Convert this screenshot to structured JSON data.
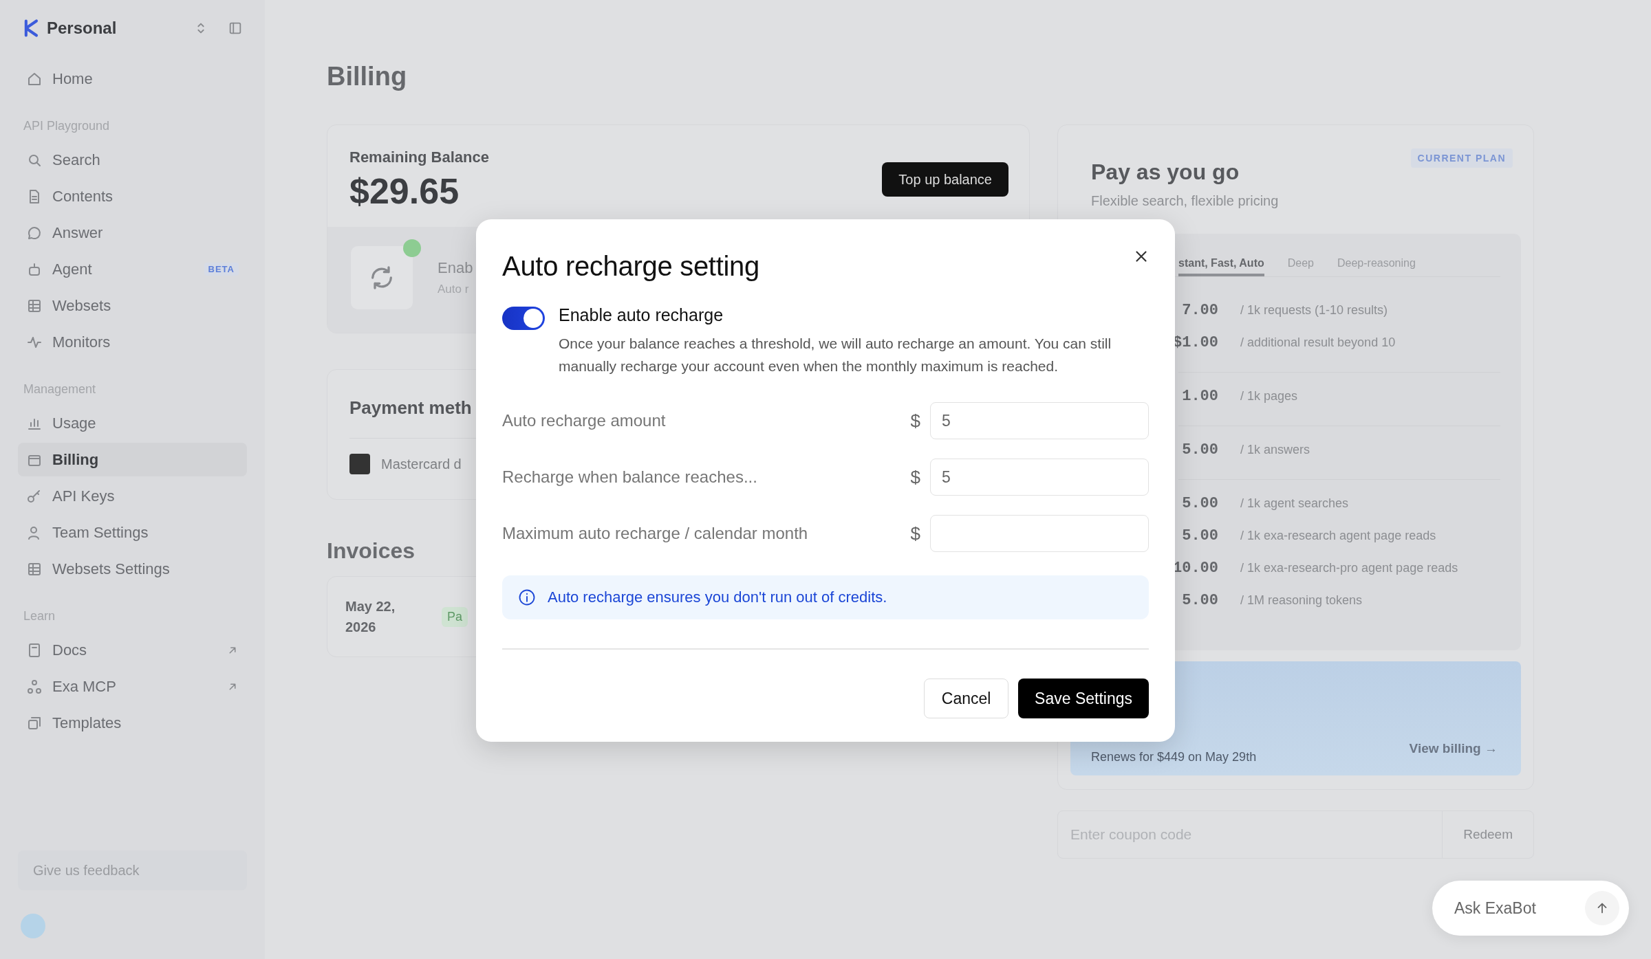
{
  "sidebar": {
    "workspace": "Personal",
    "sections": [
      {
        "items": [
          {
            "label": "Home",
            "selected": false,
            "external": false
          }
        ]
      },
      {
        "heading": "API Playground",
        "items": [
          {
            "label": "Search",
            "selected": false,
            "external": false
          },
          {
            "label": "Contents",
            "selected": false,
            "external": false
          },
          {
            "label": "Answer",
            "selected": false,
            "external": false
          },
          {
            "label": "Agent",
            "selected": false,
            "external": false,
            "badge": "BETA"
          },
          {
            "label": "Websets",
            "selected": false,
            "external": false
          },
          {
            "label": "Monitors",
            "selected": false,
            "external": false
          }
        ]
      },
      {
        "heading": "Management",
        "items": [
          {
            "label": "Usage",
            "selected": false,
            "external": false
          },
          {
            "label": "Billing",
            "selected": true,
            "external": false
          },
          {
            "label": "API Keys",
            "selected": false,
            "external": false
          },
          {
            "label": "Team Settings",
            "selected": false,
            "external": false
          },
          {
            "label": "Websets Settings",
            "selected": false,
            "external": false
          }
        ]
      },
      {
        "heading": "Learn",
        "items": [
          {
            "label": "Docs",
            "selected": false,
            "external": true
          },
          {
            "label": "Exa MCP",
            "selected": false,
            "external": true
          },
          {
            "label": "Templates",
            "selected": false,
            "external": false
          }
        ]
      }
    ],
    "feedback_button": "Give us feedback"
  },
  "page": {
    "title": "Billing",
    "balance_card": {
      "label": "Remaining Balance",
      "amount": "$29.65",
      "button": "Top up balance",
      "recharge_title": "Enab",
      "recharge_subtitle": "Auto r"
    },
    "payment_card": {
      "title": "Payment meth",
      "card": "Mastercard d"
    },
    "invoices": {
      "title": "Invoices",
      "rows": [
        {
          "date": "May 22, 2026",
          "status": "Pa"
        }
      ]
    },
    "plan_card": {
      "title": "Pay as you go",
      "subtitle": "Flexible search, flexible pricing",
      "badge": "CURRENT PLAN",
      "tabs": [
        {
          "label": "stant, Fast, Auto",
          "selected": true
        },
        {
          "label": "Deep",
          "selected": false
        },
        {
          "label": "Deep-reasoning",
          "selected": false
        }
      ],
      "price_groups": [
        [
          {
            "price": "7.00",
            "unit": "/ 1k requests (1-10 results)"
          },
          {
            "price": "$1.00",
            "unit": "/ additional result beyond 10"
          }
        ],
        [
          {
            "price": "1.00",
            "unit": "/ 1k pages"
          }
        ],
        [
          {
            "price": "5.00",
            "unit": "/ 1k answers"
          }
        ],
        [
          {
            "price": "5.00",
            "unit": "/ 1k agent searches"
          },
          {
            "price": "5.00",
            "unit": "/ 1k exa-research agent page reads"
          },
          {
            "price": "10.00",
            "unit": "/ 1k exa-research-pro agent page reads"
          },
          {
            "price": "5.00",
            "unit": "/ 1M reasoning tokens"
          }
        ]
      ],
      "renewal": "Renews for $449 on May 29th",
      "view_billing": "View billing →"
    },
    "coupon": {
      "placeholder": "Enter coupon code",
      "button": "Redeem"
    }
  },
  "modal": {
    "title": "Auto recharge setting",
    "toggle": {
      "label": "Enable auto recharge",
      "on": true
    },
    "description": "Once your balance reaches a threshold, we will auto recharge an amount. You can still manually recharge your account even when the monthly maximum is reached.",
    "fields": [
      {
        "label": "Auto recharge amount",
        "currency": "$",
        "value": "5"
      },
      {
        "label": "Recharge when balance reaches...",
        "currency": "$",
        "value": "5"
      },
      {
        "label": "Maximum auto recharge / calendar month",
        "currency": "$"
      }
    ],
    "info": "Auto recharge ensures you don't run out of credits.",
    "buttons": [
      {
        "label": "Cancel",
        "kind": "secondary"
      },
      {
        "label": "Save Settings",
        "kind": "primary"
      }
    ]
  },
  "chat": {
    "placeholder": "Ask ExaBot"
  }
}
